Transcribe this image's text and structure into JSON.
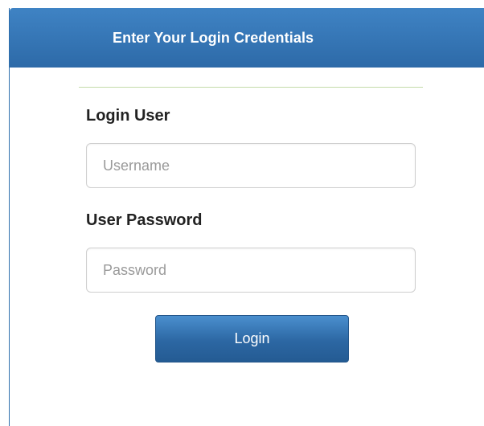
{
  "panel": {
    "title": "Enter Your Login Credentials"
  },
  "form": {
    "username_label": "Login User",
    "username_placeholder": "Username",
    "username_value": "",
    "password_label": "User Password",
    "password_placeholder": "Password",
    "password_value": "",
    "login_label": "Login"
  },
  "colors": {
    "header_bg": "#3b7bbd",
    "button_bg": "#2c67a3",
    "divider": "#c4dba9"
  }
}
